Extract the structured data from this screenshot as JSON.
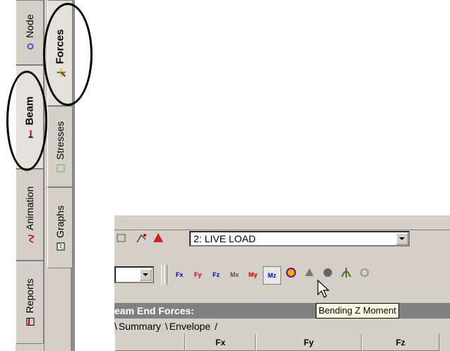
{
  "side_tabs_outer": [
    {
      "label": "Node",
      "icon": "node-icon"
    },
    {
      "label": "Beam",
      "icon": "beam-icon",
      "active": true
    },
    {
      "label": "Animation",
      "icon": "animation-icon"
    },
    {
      "label": "Reports",
      "icon": "reports-icon"
    }
  ],
  "side_tabs_inner": [
    {
      "label": "Forces",
      "icon": "forces-icon",
      "active": true
    },
    {
      "label": "Stresses",
      "icon": "stresses-icon"
    },
    {
      "label": "Graphs",
      "icon": "graphs-icon"
    }
  ],
  "toolbar": {
    "load_case": "2: LIVE LOAD",
    "force_buttons": [
      "Fx",
      "Fy",
      "Fz",
      "Mx",
      "My",
      "Mz"
    ],
    "tooltip": "Bending Z Moment"
  },
  "panel": {
    "title": "eam End Forces:",
    "tabs": [
      "Summary",
      "Envelope"
    ],
    "columns": [
      "",
      "Fx",
      "Fy",
      "Fz"
    ]
  },
  "colors": {
    "background": "#ffffff",
    "face": "#d4d0c8",
    "titlebar": "#808080",
    "tooltip": "#ffffe1"
  }
}
